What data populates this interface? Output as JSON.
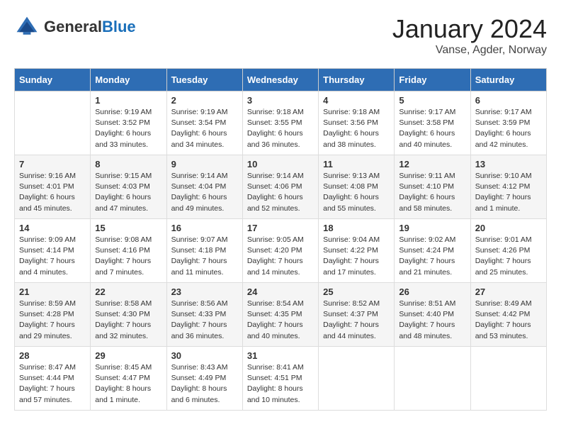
{
  "header": {
    "logo_general": "General",
    "logo_blue": "Blue",
    "month_title": "January 2024",
    "subtitle": "Vanse, Agder, Norway"
  },
  "days_of_week": [
    "Sunday",
    "Monday",
    "Tuesday",
    "Wednesday",
    "Thursday",
    "Friday",
    "Saturday"
  ],
  "weeks": [
    [
      {
        "day": "",
        "content": ""
      },
      {
        "day": "1",
        "content": "Sunrise: 9:19 AM\nSunset: 3:52 PM\nDaylight: 6 hours\nand 33 minutes."
      },
      {
        "day": "2",
        "content": "Sunrise: 9:19 AM\nSunset: 3:54 PM\nDaylight: 6 hours\nand 34 minutes."
      },
      {
        "day": "3",
        "content": "Sunrise: 9:18 AM\nSunset: 3:55 PM\nDaylight: 6 hours\nand 36 minutes."
      },
      {
        "day": "4",
        "content": "Sunrise: 9:18 AM\nSunset: 3:56 PM\nDaylight: 6 hours\nand 38 minutes."
      },
      {
        "day": "5",
        "content": "Sunrise: 9:17 AM\nSunset: 3:58 PM\nDaylight: 6 hours\nand 40 minutes."
      },
      {
        "day": "6",
        "content": "Sunrise: 9:17 AM\nSunset: 3:59 PM\nDaylight: 6 hours\nand 42 minutes."
      }
    ],
    [
      {
        "day": "7",
        "content": "Sunrise: 9:16 AM\nSunset: 4:01 PM\nDaylight: 6 hours\nand 45 minutes."
      },
      {
        "day": "8",
        "content": "Sunrise: 9:15 AM\nSunset: 4:03 PM\nDaylight: 6 hours\nand 47 minutes."
      },
      {
        "day": "9",
        "content": "Sunrise: 9:14 AM\nSunset: 4:04 PM\nDaylight: 6 hours\nand 49 minutes."
      },
      {
        "day": "10",
        "content": "Sunrise: 9:14 AM\nSunset: 4:06 PM\nDaylight: 6 hours\nand 52 minutes."
      },
      {
        "day": "11",
        "content": "Sunrise: 9:13 AM\nSunset: 4:08 PM\nDaylight: 6 hours\nand 55 minutes."
      },
      {
        "day": "12",
        "content": "Sunrise: 9:11 AM\nSunset: 4:10 PM\nDaylight: 6 hours\nand 58 minutes."
      },
      {
        "day": "13",
        "content": "Sunrise: 9:10 AM\nSunset: 4:12 PM\nDaylight: 7 hours\nand 1 minute."
      }
    ],
    [
      {
        "day": "14",
        "content": "Sunrise: 9:09 AM\nSunset: 4:14 PM\nDaylight: 7 hours\nand 4 minutes."
      },
      {
        "day": "15",
        "content": "Sunrise: 9:08 AM\nSunset: 4:16 PM\nDaylight: 7 hours\nand 7 minutes."
      },
      {
        "day": "16",
        "content": "Sunrise: 9:07 AM\nSunset: 4:18 PM\nDaylight: 7 hours\nand 11 minutes."
      },
      {
        "day": "17",
        "content": "Sunrise: 9:05 AM\nSunset: 4:20 PM\nDaylight: 7 hours\nand 14 minutes."
      },
      {
        "day": "18",
        "content": "Sunrise: 9:04 AM\nSunset: 4:22 PM\nDaylight: 7 hours\nand 17 minutes."
      },
      {
        "day": "19",
        "content": "Sunrise: 9:02 AM\nSunset: 4:24 PM\nDaylight: 7 hours\nand 21 minutes."
      },
      {
        "day": "20",
        "content": "Sunrise: 9:01 AM\nSunset: 4:26 PM\nDaylight: 7 hours\nand 25 minutes."
      }
    ],
    [
      {
        "day": "21",
        "content": "Sunrise: 8:59 AM\nSunset: 4:28 PM\nDaylight: 7 hours\nand 29 minutes."
      },
      {
        "day": "22",
        "content": "Sunrise: 8:58 AM\nSunset: 4:30 PM\nDaylight: 7 hours\nand 32 minutes."
      },
      {
        "day": "23",
        "content": "Sunrise: 8:56 AM\nSunset: 4:33 PM\nDaylight: 7 hours\nand 36 minutes."
      },
      {
        "day": "24",
        "content": "Sunrise: 8:54 AM\nSunset: 4:35 PM\nDaylight: 7 hours\nand 40 minutes."
      },
      {
        "day": "25",
        "content": "Sunrise: 8:52 AM\nSunset: 4:37 PM\nDaylight: 7 hours\nand 44 minutes."
      },
      {
        "day": "26",
        "content": "Sunrise: 8:51 AM\nSunset: 4:40 PM\nDaylight: 7 hours\nand 48 minutes."
      },
      {
        "day": "27",
        "content": "Sunrise: 8:49 AM\nSunset: 4:42 PM\nDaylight: 7 hours\nand 53 minutes."
      }
    ],
    [
      {
        "day": "28",
        "content": "Sunrise: 8:47 AM\nSunset: 4:44 PM\nDaylight: 7 hours\nand 57 minutes."
      },
      {
        "day": "29",
        "content": "Sunrise: 8:45 AM\nSunset: 4:47 PM\nDaylight: 8 hours\nand 1 minute."
      },
      {
        "day": "30",
        "content": "Sunrise: 8:43 AM\nSunset: 4:49 PM\nDaylight: 8 hours\nand 6 minutes."
      },
      {
        "day": "31",
        "content": "Sunrise: 8:41 AM\nSunset: 4:51 PM\nDaylight: 8 hours\nand 10 minutes."
      },
      {
        "day": "",
        "content": ""
      },
      {
        "day": "",
        "content": ""
      },
      {
        "day": "",
        "content": ""
      }
    ]
  ]
}
